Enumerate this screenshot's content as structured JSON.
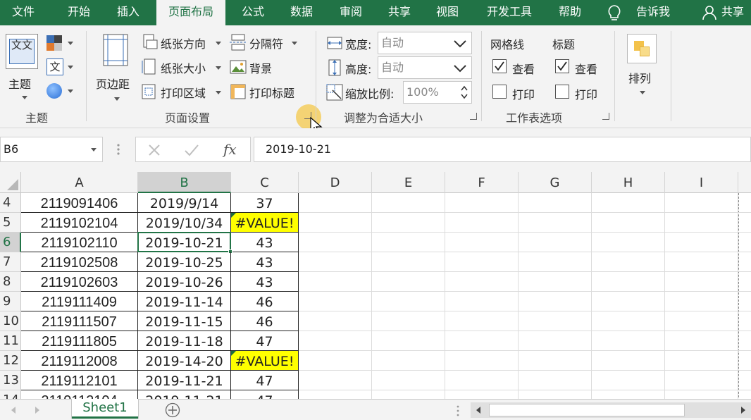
{
  "tabs": [
    {
      "label": "文件",
      "active": false
    },
    {
      "label": "开始",
      "active": false
    },
    {
      "label": "插入",
      "active": false
    },
    {
      "label": "页面布局",
      "active": true
    },
    {
      "label": "公式",
      "active": false
    },
    {
      "label": "数据",
      "active": false
    },
    {
      "label": "审阅",
      "active": false
    },
    {
      "label": "共享",
      "active": false
    },
    {
      "label": "视图",
      "active": false
    },
    {
      "label": "开发工具",
      "active": false
    },
    {
      "label": "帮助",
      "active": false
    }
  ],
  "tell_me": "告诉我",
  "share": "共享",
  "ribbon": {
    "themes": {
      "theme_button": "主题",
      "theme_icon_text": "文文",
      "group_label": "主题"
    },
    "page_setup": {
      "margins": "页边距",
      "orientation": "纸张方向",
      "size": "纸张大小",
      "print_area": "打印区域",
      "breaks": "分隔符",
      "background": "背景",
      "print_titles": "打印标题",
      "group_label": "页面设置"
    },
    "scale": {
      "width_label": "宽度:",
      "width_value": "自动",
      "height_label": "高度:",
      "height_value": "自动",
      "scale_label": "缩放比例:",
      "scale_value": "100%",
      "group_label": "调整为合适大小"
    },
    "sheet_options": {
      "gridlines": "网格线",
      "headings": "标题",
      "view": "查看",
      "print": "打印",
      "gridlines_view_checked": true,
      "gridlines_print_checked": false,
      "headings_view_checked": true,
      "headings_print_checked": false,
      "group_label": "工作表选项"
    },
    "arrange": {
      "label": "排列"
    }
  },
  "formula_bar": {
    "name_box": "B6",
    "fx": "fx",
    "value": "2019-10-21"
  },
  "columns": [
    "A",
    "B",
    "C",
    "D",
    "E",
    "F",
    "G",
    "H",
    "I"
  ],
  "selected_column": "B",
  "selected_row": "6",
  "rows": [
    {
      "n": "4",
      "a": "2119091406",
      "b": "2019/9/14",
      "c": "37"
    },
    {
      "n": "5",
      "a": "2119102104",
      "b": "2019/10/34",
      "c": "#VALUE!",
      "error": true
    },
    {
      "n": "6",
      "a": "2119102110",
      "b": "2019-10-21",
      "c": "43"
    },
    {
      "n": "7",
      "a": "2119102508",
      "b": "2019-10-25",
      "c": "43"
    },
    {
      "n": "8",
      "a": "2119102603",
      "b": "2019-10-26",
      "c": "43"
    },
    {
      "n": "9",
      "a": "2119111409",
      "b": "2019-11-14",
      "c": "46"
    },
    {
      "n": "10",
      "a": "2119111507",
      "b": "2019-11-15",
      "c": "46"
    },
    {
      "n": "11",
      "a": "2119111805",
      "b": "2019-11-18",
      "c": "47"
    },
    {
      "n": "12",
      "a": "2119112008",
      "b": "2019-14-20",
      "c": "#VALUE!",
      "error": true
    },
    {
      "n": "13",
      "a": "2119112101",
      "b": "2019-11-21",
      "c": "47"
    },
    {
      "n": "14",
      "a": "2119112104",
      "b": "2019-11-21",
      "c": "47"
    }
  ],
  "sheet_tab": "Sheet1",
  "colors": {
    "brand": "#217346",
    "error_fill": "#ffff00",
    "cursor_highlight": "#f4c84a"
  }
}
